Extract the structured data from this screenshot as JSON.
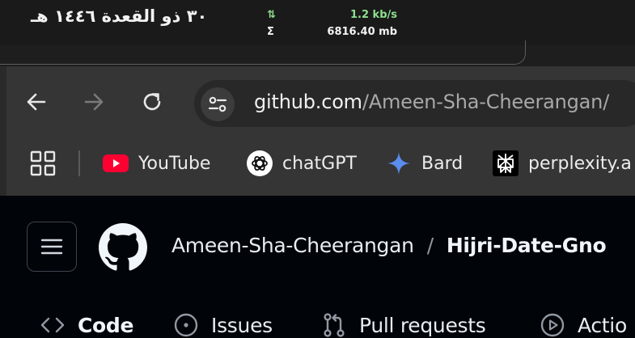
{
  "system_panel": {
    "hijri_date": "٣٠ ذو القعدة ١٤٤٦ هـ",
    "net_speed_icon": "⇅",
    "net_speed": "1.2 kb/s",
    "net_total_icon": "Σ",
    "net_total": "6816.40 mb",
    "colors": {
      "speed": "#8de08d",
      "text": "#f2f2f2"
    }
  },
  "browser": {
    "nav": {
      "back": "back-arrow-icon",
      "forward": "forward-arrow-icon",
      "reload": "reload-icon"
    },
    "omnibox": {
      "site_settings_icon": "tune-icon",
      "url_host": "github.com",
      "url_path": "/Ameen-Sha-Cheerangan/"
    },
    "bookmarks": [
      {
        "label": "YouTube",
        "icon": "youtube-icon"
      },
      {
        "label": "chatGPT",
        "icon": "chatgpt-icon"
      },
      {
        "label": "Bard",
        "icon": "bard-icon"
      },
      {
        "label": "perplexity.a",
        "icon": "perplexity-icon"
      }
    ]
  },
  "github": {
    "breadcrumb": {
      "owner": "Ameen-Sha-Cheerangan",
      "separator": "/",
      "repo": "Hijri-Date-Gno"
    },
    "repo_nav": [
      {
        "label": "Code",
        "icon": "code-icon",
        "active": true
      },
      {
        "label": "Issues",
        "icon": "issue-opened-icon",
        "active": false
      },
      {
        "label": "Pull requests",
        "icon": "git-pull-request-icon",
        "active": false
      },
      {
        "label": "Actio",
        "icon": "play-icon",
        "active": false
      }
    ],
    "colors": {
      "bg": "#010409",
      "border": "#3d444d",
      "text": "#e6edf3",
      "muted": "#9198a1"
    }
  }
}
